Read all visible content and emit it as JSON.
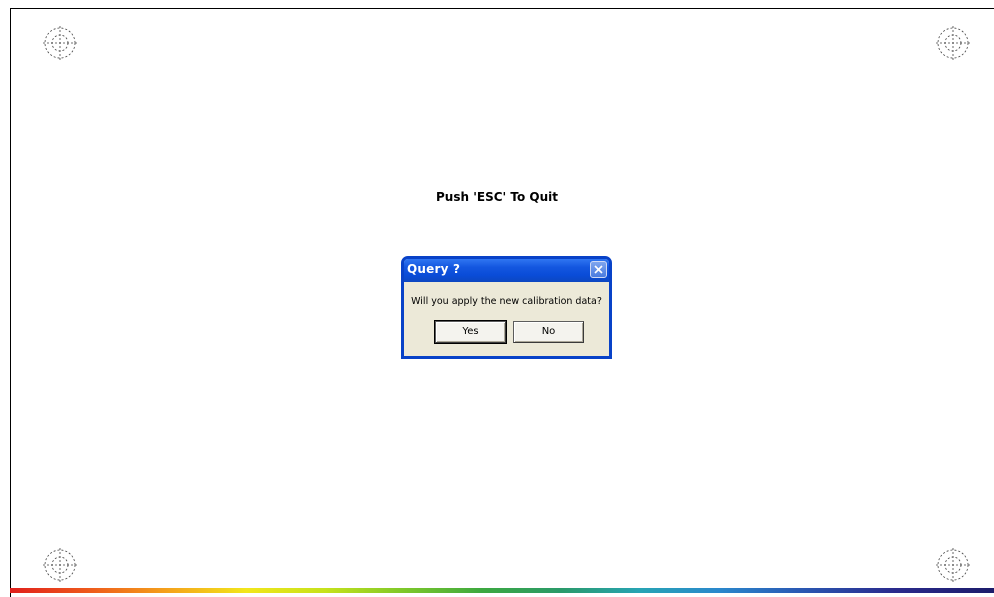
{
  "instruction": {
    "text": "Push 'ESC' To Quit"
  },
  "dialog": {
    "title": "Query ?",
    "message": "Will you apply the new calibration data?",
    "buttons": {
      "yes": "Yes",
      "no": "No"
    },
    "close_icon": "close-icon"
  },
  "targets": {
    "icon": "crosshair-target-icon",
    "count": 4
  },
  "colors": {
    "titlebar": "#0a4cd8",
    "dialog_border": "#0842c8",
    "dialog_face": "#ece9d8",
    "background": "#ffffff"
  }
}
